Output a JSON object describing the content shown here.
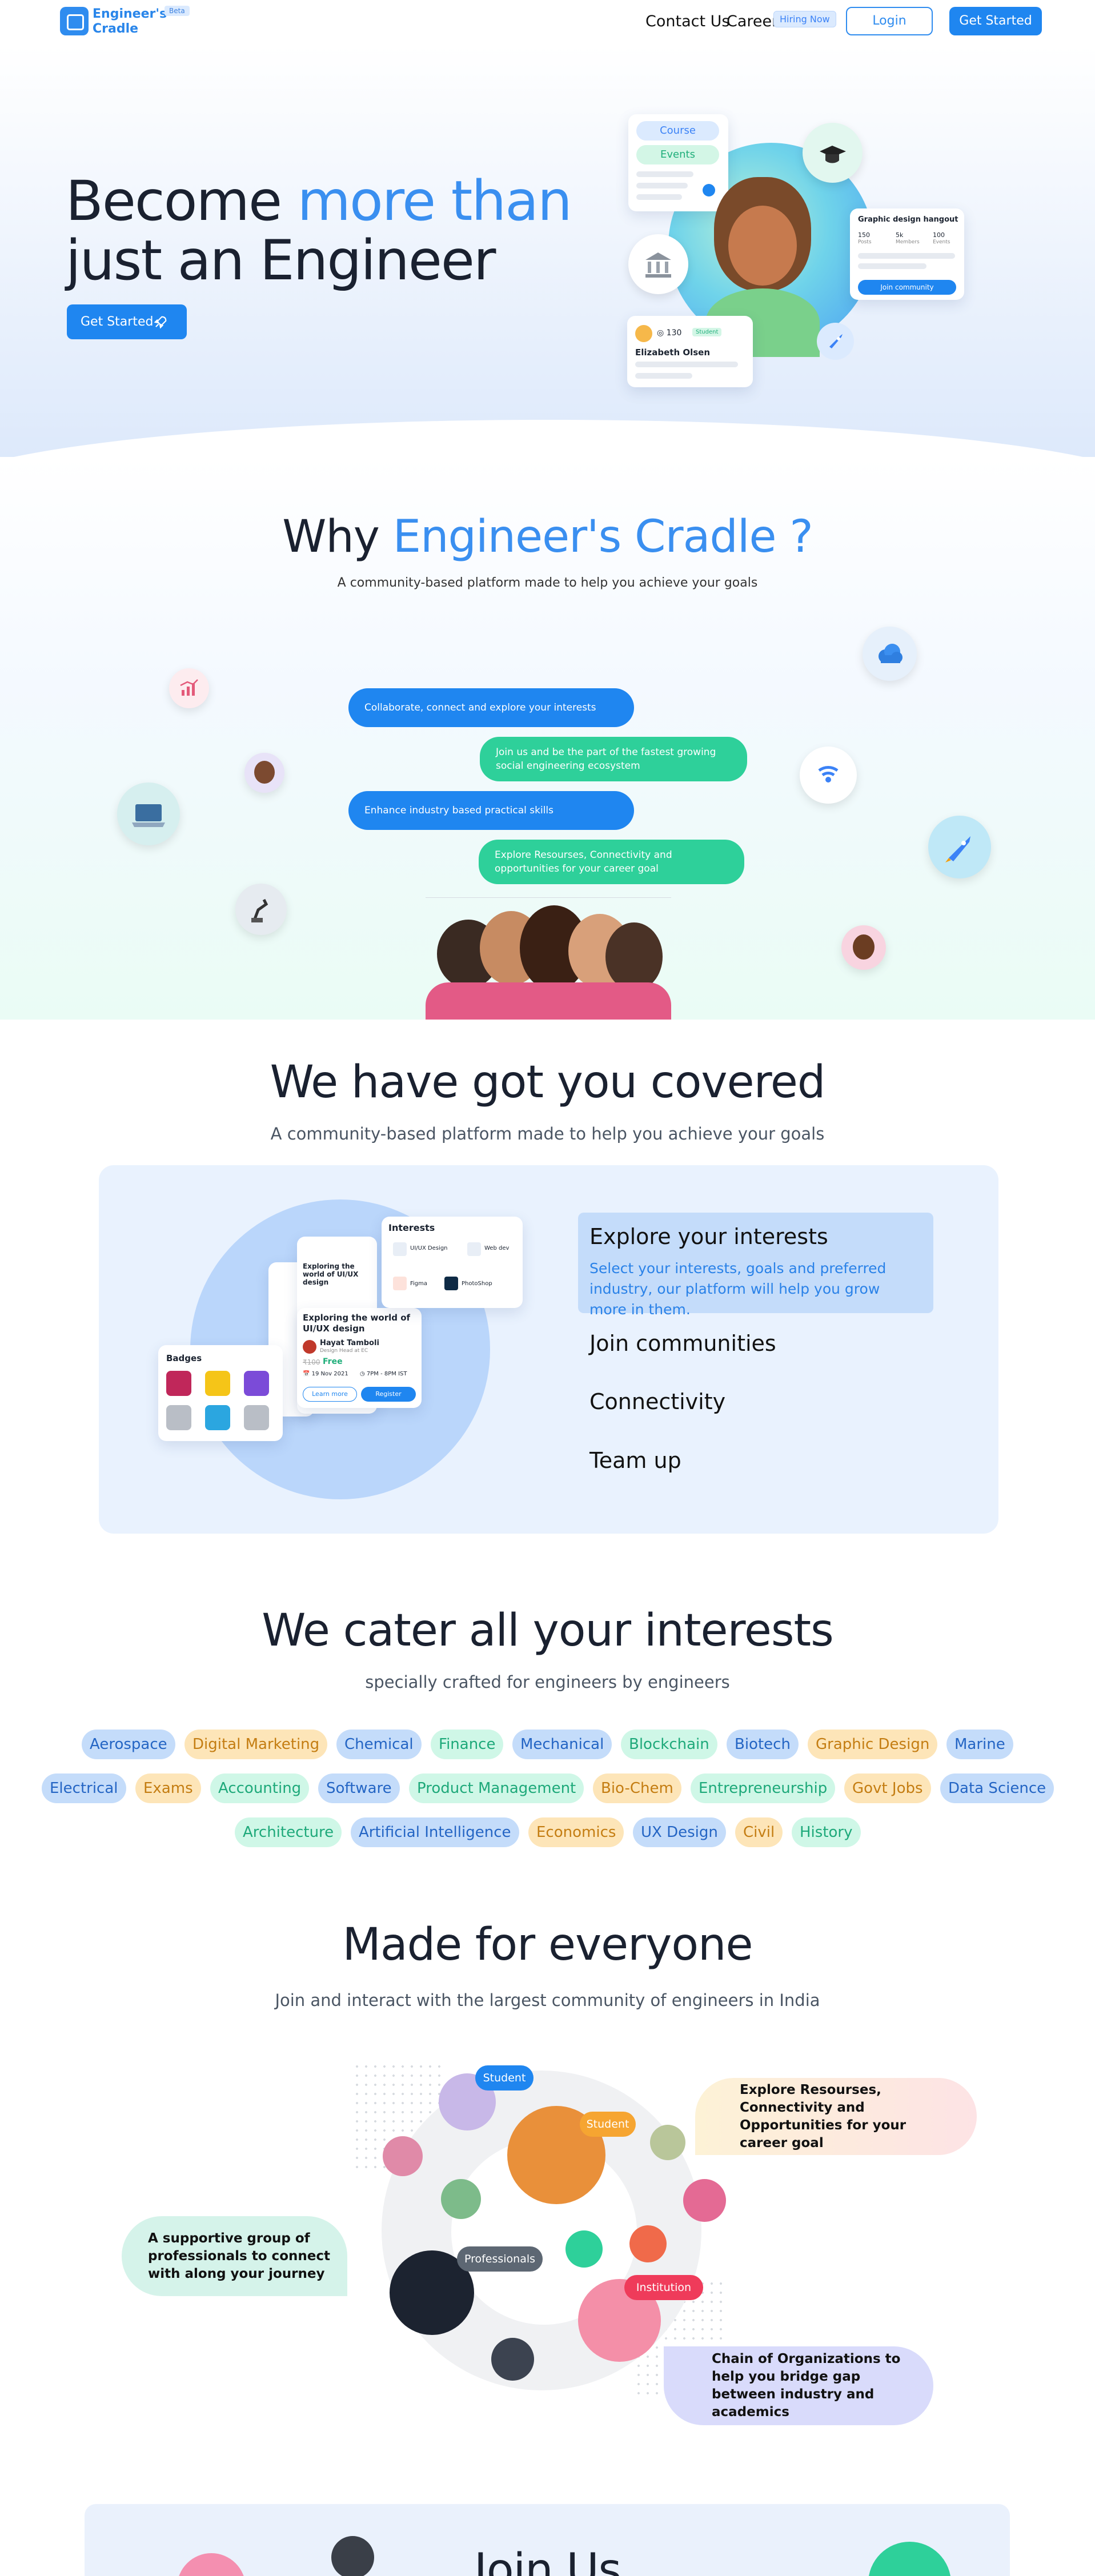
{
  "header": {
    "logo_line1": "Engineer's",
    "logo_line2": "Cradle",
    "beta": "Beta",
    "contact": "Contact Us",
    "career": "Career",
    "hiring": "Hiring Now",
    "login": "Login",
    "get_started": "Get Started"
  },
  "hero": {
    "title_part1": "Become",
    "title_part2": "more than",
    "title_part3": "just an Engineer",
    "cta": "Get Started",
    "card_course": "Course",
    "card_events": "Events",
    "graphic_title": "Graphic design hangout",
    "stat1": "150",
    "stat1_label": "Posts",
    "stat2": "5k",
    "stat2_label": "Members",
    "stat3": "100",
    "stat3_label": "Events",
    "join_community": "Join community",
    "profile_points": "130",
    "profile_badge": "Student",
    "profile_name": "Elizabeth Olsen"
  },
  "why": {
    "title_part1": "Why",
    "title_part2": "Engineer's Cradle ?",
    "subtitle": "A community-based platform made to help you achieve your goals",
    "bubble1": "Collaborate, connect and explore your interests",
    "bubble2": "Join us and be the part of the fastest growing social engineering ecosystem",
    "bubble3": "Enhance industry based practical skills",
    "bubble4": "Explore Resourses, Connectivity and opportunities for your career goal"
  },
  "covered": {
    "title": "We have got you covered",
    "subtitle": "A community-based platform made to help you achieve your goals",
    "interests_card_title": "Interests",
    "interest1": "UI/UX Design",
    "interest2": "Web dev",
    "interest3": "Figma",
    "interest4": "PhotoShop",
    "event_title": "Exploring the world of UI/UX design",
    "speaker": "Hayat Tamboli",
    "speaker_role": "Design Head at EC",
    "price_old": "₹100",
    "price": "Free",
    "date": "19 Nov 2021",
    "time": "7PM - 8PM IST",
    "learn_more": "Learn more",
    "register": "Register",
    "badges_title": "Badges",
    "tabs": [
      {
        "title": "Explore your interests",
        "desc": "Select your interests, goals and preferred industry, our platform will help you grow more in them."
      },
      {
        "title": "Join communities"
      },
      {
        "title": "Connectivity"
      },
      {
        "title": "Team up"
      }
    ]
  },
  "interests": {
    "title": "We cater all your interests",
    "subtitle": "specially crafted for engineers by engineers",
    "row1": [
      "Aerospace",
      "Digital Marketing",
      "Chemical",
      "Finance",
      "Mechanical",
      "Blockchain",
      "Biotech",
      "Graphic Design",
      "Marine"
    ],
    "row2": [
      "Electrical",
      "Exams",
      "Accounting",
      "Software",
      "Product Management",
      "Bio-Chem",
      "Entrepreneurship",
      "Govt Jobs",
      "Data Science"
    ],
    "row3": [
      "Architecture",
      "Artificial Intelligence",
      "Economics",
      "UX Design",
      "Civil",
      "History"
    ]
  },
  "everyone": {
    "title": "Made for everyone",
    "subtitle": "Join and interact with the largest community of engineers in India",
    "label_student1": "Student",
    "label_student2": "Student",
    "label_professionals": "Professionals",
    "label_institution": "Institution",
    "quote1": "Explore Resourses, Connectivity and Opportunities for your career goal",
    "quote2": "A supportive group of professionals to connect with along your journey",
    "quote3": "Chain of Organizations to help you bridge gap between industry and academics"
  },
  "join": {
    "title": "Join Us"
  },
  "colors": {
    "primary": "#1f86f0",
    "accent_blue_text": "#3a8ff0",
    "green": "#2ed09a",
    "institution_red": "#ef3b5a",
    "student_orange": "#f6a531"
  }
}
